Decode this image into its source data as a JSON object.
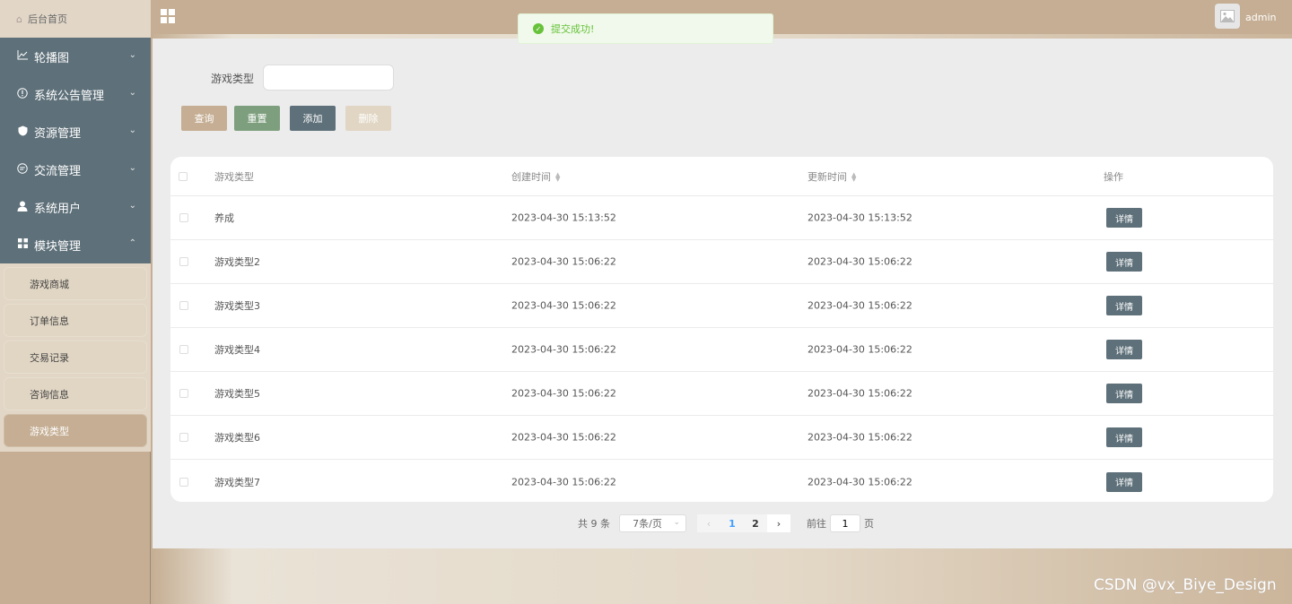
{
  "header": {
    "site_title": "",
    "user": "admin",
    "icons": {
      "menu_toggle": "grid-icon",
      "avatar": "image-placeholder-icon"
    }
  },
  "sidebar": {
    "home_label": "后台首页",
    "menus": [
      {
        "label": "轮播图",
        "icon": "chart-icon",
        "expanded": false
      },
      {
        "label": "系统公告管理",
        "icon": "info-icon",
        "expanded": false
      },
      {
        "label": "资源管理",
        "icon": "shield-icon",
        "expanded": false
      },
      {
        "label": "交流管理",
        "icon": "chat-icon",
        "expanded": false
      },
      {
        "label": "系统用户",
        "icon": "user-icon",
        "expanded": false
      },
      {
        "label": "模块管理",
        "icon": "grid-icon",
        "expanded": true
      }
    ],
    "submenu": [
      {
        "label": "游戏商城",
        "active": false
      },
      {
        "label": "订单信息",
        "active": false
      },
      {
        "label": "交易记录",
        "active": false
      },
      {
        "label": "咨询信息",
        "active": false
      },
      {
        "label": "游戏类型",
        "active": true
      }
    ]
  },
  "toast": {
    "message": "提交成功!",
    "color": "#67c23a"
  },
  "search": {
    "label": "游戏类型",
    "value": ""
  },
  "buttons": {
    "query": "查询",
    "reset": "重置",
    "add": "添加",
    "delete": "删除"
  },
  "table": {
    "columns": [
      "游戏类型",
      "创建时间",
      "更新时间",
      "操作"
    ],
    "rows": [
      {
        "type": "养成",
        "created": "2023-04-30 15:13:52",
        "updated": "2023-04-30 15:13:52",
        "action": "详情"
      },
      {
        "type": "游戏类型2",
        "created": "2023-04-30 15:06:22",
        "updated": "2023-04-30 15:06:22",
        "action": "详情"
      },
      {
        "type": "游戏类型3",
        "created": "2023-04-30 15:06:22",
        "updated": "2023-04-30 15:06:22",
        "action": "详情"
      },
      {
        "type": "游戏类型4",
        "created": "2023-04-30 15:06:22",
        "updated": "2023-04-30 15:06:22",
        "action": "详情"
      },
      {
        "type": "游戏类型5",
        "created": "2023-04-30 15:06:22",
        "updated": "2023-04-30 15:06:22",
        "action": "详情"
      },
      {
        "type": "游戏类型6",
        "created": "2023-04-30 15:06:22",
        "updated": "2023-04-30 15:06:22",
        "action": "详情"
      },
      {
        "type": "游戏类型7",
        "created": "2023-04-30 15:06:22",
        "updated": "2023-04-30 15:06:22",
        "action": "详情"
      }
    ]
  },
  "pagination": {
    "total": "共 9 条",
    "page_size": "7条/页",
    "pages": [
      "1",
      "2"
    ],
    "current": "1",
    "goto_prefix": "前往",
    "goto_value": "1",
    "goto_suffix": "页"
  },
  "watermark": "CSDN @vx_Biye_Design",
  "colors": {
    "sidebar": "#5e7079",
    "accent": "#c5ae93",
    "reset": "#7e9f7e",
    "submenu": "#e1d6c4"
  }
}
